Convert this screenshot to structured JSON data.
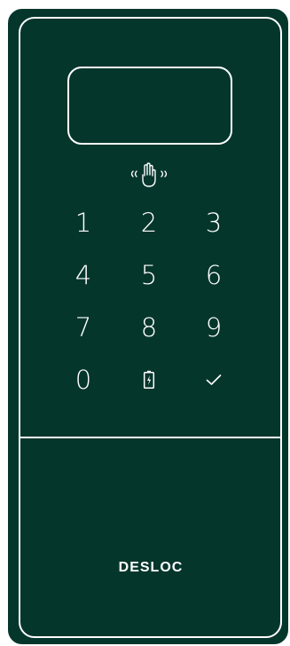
{
  "keypad": {
    "rows": [
      [
        "1",
        "2",
        "3"
      ],
      [
        "4",
        "5",
        "6"
      ],
      [
        "7",
        "8",
        "9"
      ],
      [
        "0",
        "battery-icon",
        "check-icon"
      ]
    ]
  },
  "icons": {
    "nfc": "hand-nfc-icon",
    "battery": "battery-icon",
    "confirm": "check-icon"
  },
  "brand": {
    "logo_text": "DESLOC"
  },
  "colors": {
    "body": "#05362c",
    "line": "#ffffff"
  }
}
